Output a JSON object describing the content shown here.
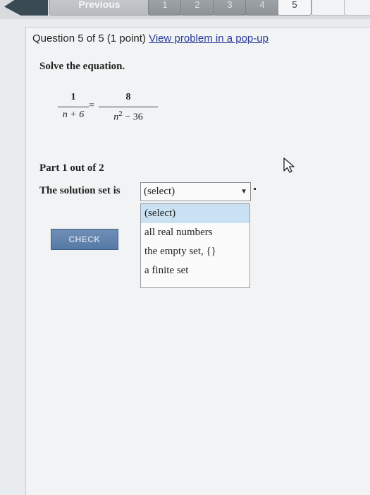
{
  "nav": {
    "previous_label": "Previous",
    "pages": [
      "1",
      "2",
      "3",
      "4",
      "5"
    ],
    "current_page": "5"
  },
  "question": {
    "header_prefix": "Question 5 of 5 (1 point)",
    "popup_link": "View problem in a pop-up",
    "instruction": "Solve the equation.",
    "equation": {
      "left": {
        "numerator": "1",
        "denominator": "n + 6"
      },
      "right": {
        "numerator": "8",
        "denominator_base": "n",
        "denominator_exp": "2",
        "denominator_rest": " − 36"
      },
      "operator": "="
    }
  },
  "part": {
    "label": "Part 1 out of 2",
    "solution_label": "The solution set is",
    "select_value": "(select)",
    "options": [
      "(select)",
      "all real numbers",
      "the empty set, {}",
      "a finite set"
    ]
  },
  "check_label": "CHECK",
  "colors": {
    "selected_option": "#c9e1f2",
    "check_button": "#5f82ad",
    "link": "#2a3a9a"
  }
}
